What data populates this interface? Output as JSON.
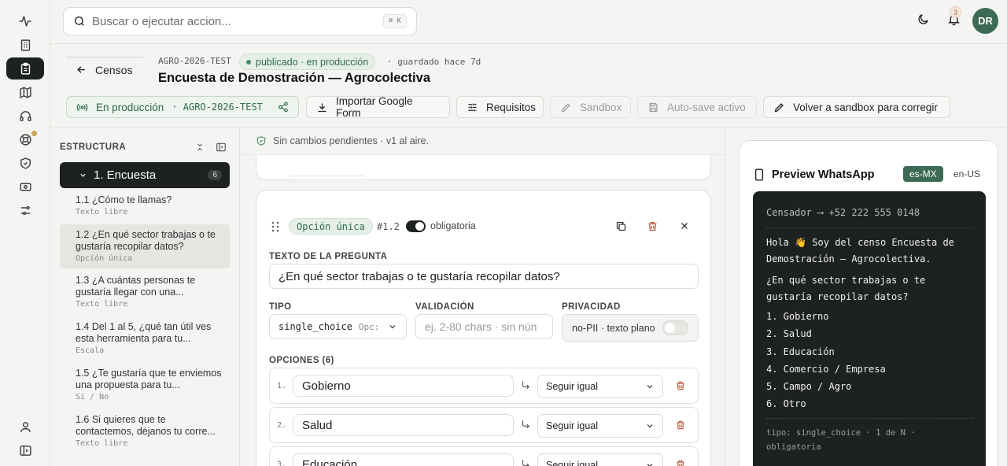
{
  "topbar": {
    "search_placeholder": "Buscar o ejecutar accion...",
    "search_kbd": "⌘ K",
    "notifications_count": "3",
    "avatar_initials": "DR"
  },
  "header": {
    "back_label": "Censos",
    "survey_code": "AGRO-2026-TEST",
    "status": "publicado · en producción",
    "saved": "· guardado hace 7d",
    "title": "Encuesta de Demostración — Agrocolectiva",
    "toolbar": {
      "prod_label": "En producción",
      "prod_code": "· AGRO-2026-TEST",
      "import_label": "Importar Google Form",
      "requirements_label": "Requisitos",
      "sandbox_label": "Sandbox",
      "autosave_label": "Auto-save activo",
      "back_sandbox_label": "Volver a sandbox para corregir"
    }
  },
  "structure": {
    "title": "ESTRUCTURA",
    "section_label": "1. Encuesta",
    "section_count": "6",
    "questions": [
      {
        "label": "1.1 ¿Cómo te llamas?",
        "type": "Texto libre"
      },
      {
        "label": "1.2 ¿En qué sector trabajas o te gustaría recopilar datos?",
        "type": "Opción única"
      },
      {
        "label": "1.3 ¿A cuántas personas te gustaría llegar con una...",
        "type": "Texto libre"
      },
      {
        "label": "1.4 Del 1 al 5, ¿qué tan útil ves esta herramienta para tu...",
        "type": "Escala"
      },
      {
        "label": "1.5 ¿Te gustaría que te enviemos una propuesta para tu...",
        "type": "Sí / No"
      },
      {
        "label": "1.6 Si quieres que te contactemos, déjanos tu corre...",
        "type": "Texto libre"
      }
    ]
  },
  "editor": {
    "pending": "Sin cambios pendientes · v1 al aire.",
    "type_pill": "Opción única",
    "qnum": "#1.2",
    "required_label": "obligatoria",
    "question_text_label": "TEXTO DE LA PREGUNTA",
    "question_text": "¿En qué sector trabajas o te gustaría recopilar datos?",
    "type_label": "TIPO",
    "type_value": "single_choice",
    "type_hint": "Opc:",
    "validation_label": "VALIDACIÓN",
    "validation_placeholder": "ej. 2-80 chars · sin nún",
    "privacy_label": "PRIVACIDAD",
    "privacy_value": "no-PII · texto plano",
    "options_label": "OPCIONES (6)",
    "options": [
      {
        "idx": "1.",
        "label": "Gobierno",
        "flow": "Seguir igual"
      },
      {
        "idx": "2.",
        "label": "Salud",
        "flow": "Seguir igual"
      },
      {
        "idx": "3.",
        "label": "Educación",
        "flow": "Seguir igual"
      }
    ]
  },
  "preview": {
    "title": "Preview WhatsApp",
    "lang_active": "es-MX",
    "lang_other": "en-US",
    "from": "Censador ⟶ +52 222 555 0148",
    "greeting": "Hola 👋 Soy del censo Encuesta de Demostración — Agrocolectiva.",
    "question": "¿En qué sector trabajas o te gustaría recopilar datos?",
    "options": [
      "1. Gobierno",
      "2. Salud",
      "3. Educación",
      "4. Comercio / Empresa",
      "5. Campo / Agro",
      "6. Otro"
    ],
    "meta": "tipo: single_choice · 1 de N · obligatoria"
  },
  "colors": {
    "accent_green": "#3c6a55",
    "dark": "#1d211f",
    "danger": "#b5553a"
  }
}
